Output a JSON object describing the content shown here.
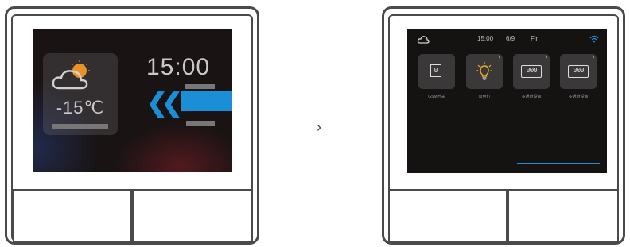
{
  "left_screen": {
    "temperature": "-15℃",
    "time": "15:00",
    "chevrons": "❮❮"
  },
  "between_arrow": "›",
  "right_screen": {
    "status": {
      "time": "15:00",
      "date": "6/9",
      "weekday": "Fir"
    },
    "tiles": [
      {
        "glyph": "0",
        "label": "GSM开关",
        "icon": "switch-icon"
      },
      {
        "glyph": "",
        "label": "双色灯",
        "icon": "bulb-icon"
      },
      {
        "glyph": "000",
        "label": "多通道设备",
        "icon": "multi-channel-icon"
      },
      {
        "glyph": "000",
        "label": "多通道设备",
        "icon": "multi-channel-icon"
      }
    ]
  },
  "colors": {
    "accent_blue": "#1a8fd8",
    "screen_bg": "#151212",
    "sun": "#e8912a"
  }
}
